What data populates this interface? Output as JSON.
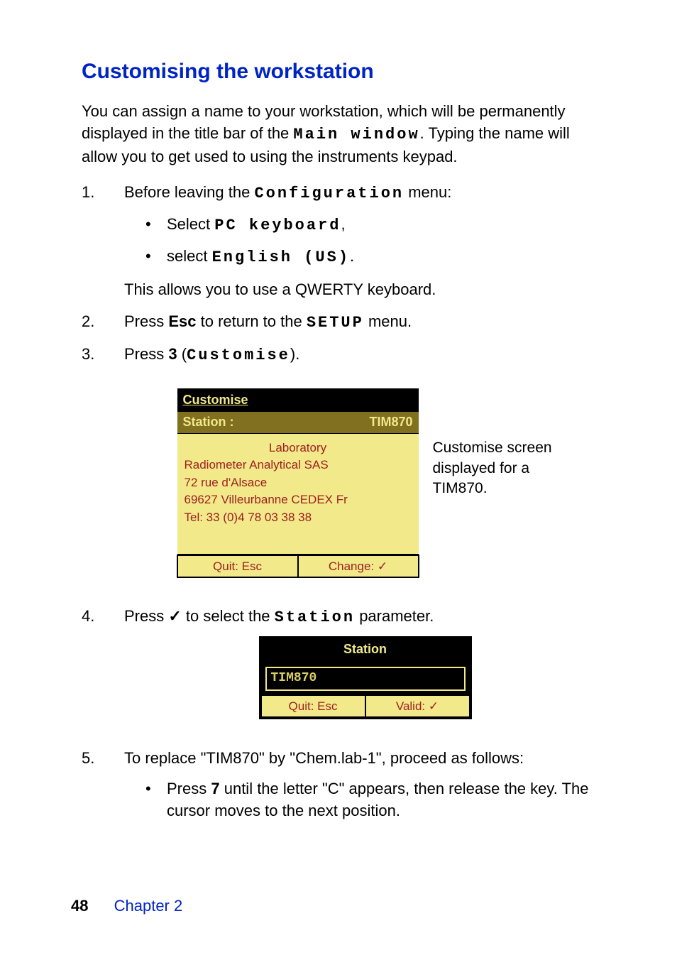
{
  "heading": "Customising the workstation",
  "intro_part1": "You can assign a name to your workstation, which will be permanently displayed in the title bar of the ",
  "intro_mono": "Main window",
  "intro_part2": ". Typing the name will allow you to get used to using the instruments keypad.",
  "steps": {
    "s1": {
      "lead": "Before leaving the ",
      "mono": "Configuration",
      "tail": " menu:"
    },
    "s1_sub1": {
      "lead": "Select ",
      "mono": "PC keyboard",
      "tail": ","
    },
    "s1_sub2": {
      "lead": "select ",
      "mono": "English (US)",
      "tail": "."
    },
    "s1_note": "This allows you to use a QWERTY keyboard.",
    "s2": {
      "a": "Press ",
      "b": "Esc",
      "c": " to return to the ",
      "d": "SETUP",
      "e": " menu."
    },
    "s3": {
      "a": "Press ",
      "b": "3",
      "c": " (",
      "d": "Customise",
      "e": ")."
    },
    "s4": {
      "a": "Press ",
      "b": "✓",
      "c": " to select the ",
      "d": "Station",
      "e": " parameter."
    },
    "s5": "To replace \"TIM870\" by \"Chem.lab-1\", proceed as follows:",
    "s5_sub1": {
      "a": "Press ",
      "b": "7",
      "c": " until the letter \"C\" appears, then release the key. The cursor moves to the next position."
    }
  },
  "figure1": {
    "title": "Customise",
    "station_label": "Station :",
    "station_value": "TIM870",
    "line_center": "Laboratory",
    "line1": "Radiometer Analytical SAS",
    "line2": "72 rue d'Alsace",
    "line3": "69627 Villeurbanne CEDEX Fr",
    "line4": "Tel: 33 (0)4 78 03 38 38",
    "btn_left": "Quit: Esc",
    "btn_right": "Change: ✓",
    "caption": "Customise screen displayed for a TIM870."
  },
  "figure2": {
    "title": "Station",
    "value": "TIM870",
    "btn_left": "Quit: Esc",
    "btn_right": "Valid: ✓"
  },
  "footer": {
    "page": "48",
    "chapter": "Chapter  2"
  }
}
